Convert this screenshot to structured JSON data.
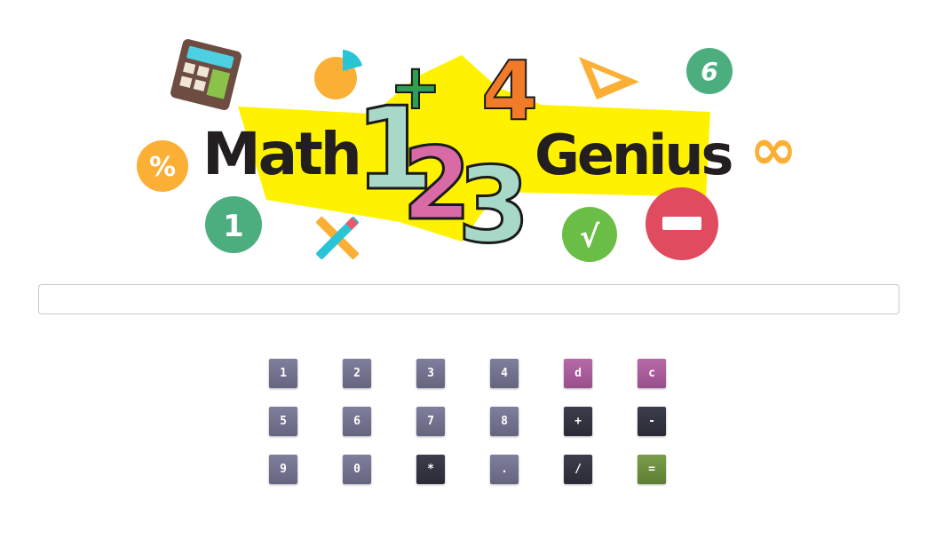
{
  "banner": {
    "word_left": "Math",
    "word_right": "Genius",
    "digits": [
      "1",
      "+",
      "4",
      "2",
      "3"
    ],
    "decorations": {
      "percent": "%",
      "one": "1",
      "six": "6",
      "sqrt": "√",
      "infinity": "∞"
    }
  },
  "display": {
    "value": "",
    "placeholder": ""
  },
  "keypad": {
    "keys": [
      {
        "label": "1",
        "kind": "num"
      },
      {
        "label": "2",
        "kind": "num"
      },
      {
        "label": "3",
        "kind": "num"
      },
      {
        "label": "4",
        "kind": "num"
      },
      {
        "label": "d",
        "kind": "fn"
      },
      {
        "label": "c",
        "kind": "fn"
      },
      {
        "label": "5",
        "kind": "num"
      },
      {
        "label": "6",
        "kind": "num"
      },
      {
        "label": "7",
        "kind": "num"
      },
      {
        "label": "8",
        "kind": "num"
      },
      {
        "label": "+",
        "kind": "op"
      },
      {
        "label": "-",
        "kind": "op"
      },
      {
        "label": "9",
        "kind": "num"
      },
      {
        "label": "0",
        "kind": "num"
      },
      {
        "label": "*",
        "kind": "op"
      },
      {
        "label": ".",
        "kind": "num"
      },
      {
        "label": "/",
        "kind": "op"
      },
      {
        "label": "=",
        "kind": "eq"
      }
    ]
  },
  "colors": {
    "key_number": "#72728e",
    "key_function": "#a95d9b",
    "key_operator": "#34353f",
    "key_equals": "#6d8e40",
    "banner_yellow": "#fff200",
    "text_dark": "#231f20"
  }
}
